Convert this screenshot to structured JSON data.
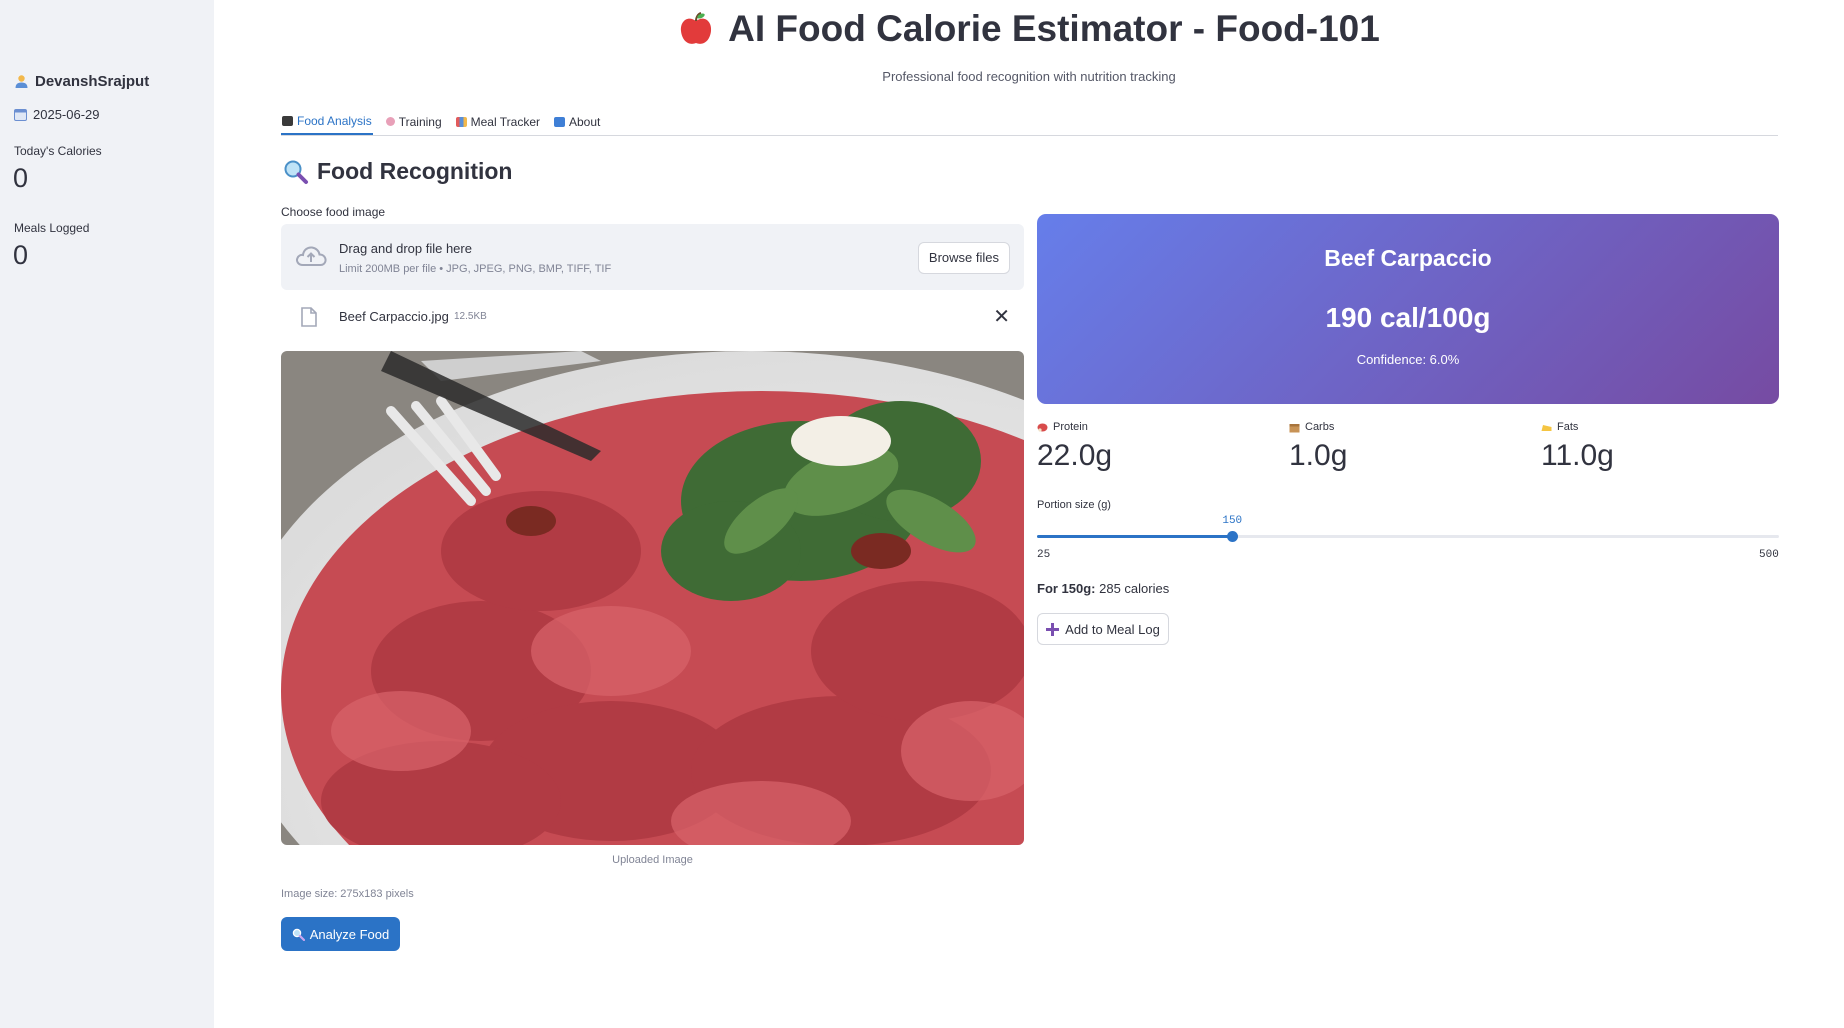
{
  "sidebar": {
    "username": "DevanshSrajput",
    "date": "2025-06-29",
    "todays_calories_label": "Today's Calories",
    "todays_calories_value": "0",
    "meals_logged_label": "Meals Logged",
    "meals_logged_value": "0"
  },
  "header": {
    "title": "AI Food Calorie Estimator - Food-101",
    "subtitle": "Professional food recognition with nutrition tracking"
  },
  "tabs": [
    {
      "label": "Food Analysis",
      "icon": "camera-icon",
      "active": true
    },
    {
      "label": "Training",
      "icon": "brain-icon",
      "active": false
    },
    {
      "label": "Meal Tracker",
      "icon": "bar-chart-icon",
      "active": false
    },
    {
      "label": "About",
      "icon": "info-icon",
      "active": false
    }
  ],
  "recognition": {
    "section_title": "Food Recognition",
    "upload_label": "Choose food image",
    "dropzone_title": "Drag and drop file here",
    "dropzone_limit": "Limit 200MB per file • JPG, JPEG, PNG, BMP, TIFF, TIF",
    "browse_label": "Browse files",
    "file_name": "Beef Carpaccio.jpg",
    "file_size": "12.5KB",
    "image_caption": "Uploaded Image",
    "image_size_text": "Image size: 275x183 pixels",
    "analyze_label": "Analyze Food"
  },
  "result": {
    "food_name": "Beef Carpaccio",
    "calories_per_100g": "190 cal/100g",
    "confidence": "Confidence: 6.0%",
    "card_gradient": [
      "#667eea",
      "#764ba2"
    ]
  },
  "macros": [
    {
      "label": "Protein",
      "value": "22.0g",
      "icon": "meat-icon"
    },
    {
      "label": "Carbs",
      "value": "1.0g",
      "icon": "box-icon"
    },
    {
      "label": "Fats",
      "value": "11.0g",
      "icon": "cheese-icon"
    }
  ],
  "portion": {
    "label": "Portion size (g)",
    "value": 150,
    "value_text": "150",
    "min": 25,
    "max": 500,
    "min_text": "25",
    "max_text": "500",
    "result_bold": "For 150g:",
    "result_text": " 285 calories",
    "add_label": "Add to Meal Log"
  },
  "colors": {
    "accent": "#2b73c6",
    "sidebar_bg": "#f0f2f6"
  }
}
